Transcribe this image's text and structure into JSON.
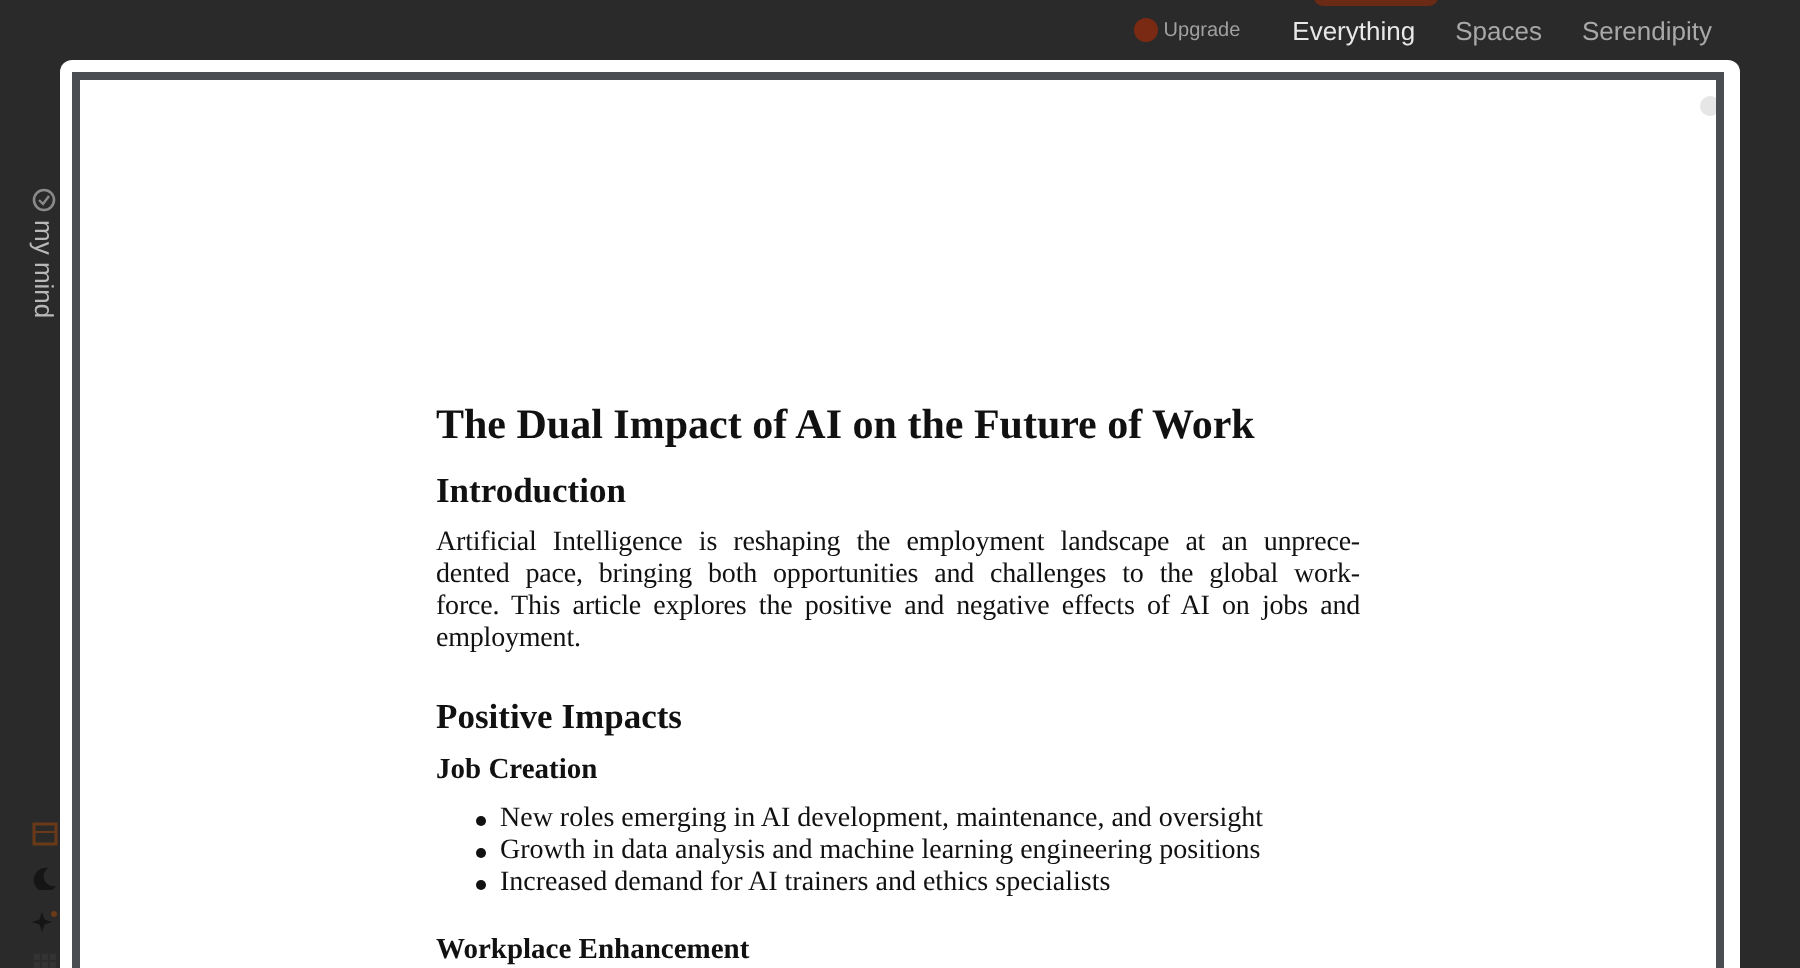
{
  "top_nav": {
    "upgrade": "Upgrade",
    "tabs": [
      {
        "label": "Everything",
        "selected": true
      },
      {
        "label": "Spaces",
        "selected": false
      },
      {
        "label": "Serendipity",
        "selected": false
      }
    ]
  },
  "sidebar": {
    "label": "my mind"
  },
  "document": {
    "title": "The Dual Impact of AI on the Future of Work",
    "sections": [
      {
        "heading": "Introduction",
        "blocks": [
          {
            "kind": "paragraph",
            "lines": [
              "Artificial Intelligence is reshaping the employment landscape at an unprece-",
              "dented pace, bringing both opportunities and challenges to the global work-",
              "force. This article explores the positive and negative effects of AI on jobs and",
              "employment."
            ]
          }
        ]
      },
      {
        "heading": "Positive Impacts",
        "blocks": [
          {
            "kind": "subheading",
            "text": "Job Creation"
          },
          {
            "kind": "list",
            "items": [
              "New roles emerging in AI development, maintenance, and oversight",
              "Growth in data analysis and machine learning engineering positions",
              "Increased demand for AI trainers and ethics specialists"
            ]
          },
          {
            "kind": "subheading",
            "text": "Workplace Enhancement"
          }
        ]
      }
    ]
  }
}
